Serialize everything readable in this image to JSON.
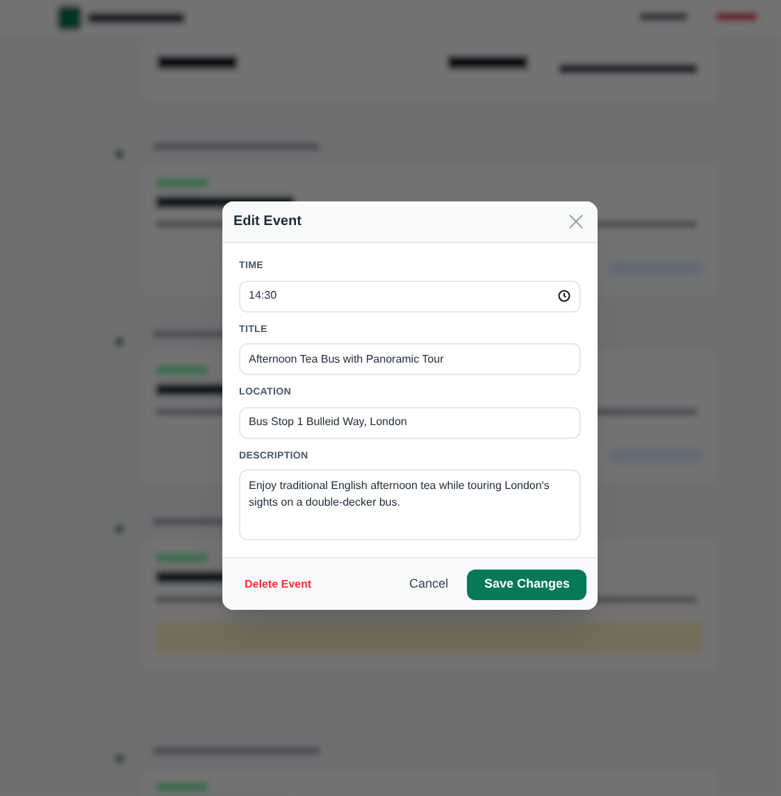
{
  "dialog": {
    "title": "Edit Event",
    "fields": [
      {
        "label": "TIME",
        "kind": "time",
        "value": "14:30"
      },
      {
        "label": "TITLE",
        "kind": "text",
        "value": "Afternoon Tea Bus with Panoramic Tour"
      },
      {
        "label": "LOCATION",
        "kind": "text",
        "value": "Bus Stop 1 Bulleid Way, London"
      },
      {
        "label": "DESCRIPTION",
        "kind": "textarea",
        "value": "Enjoy traditional English afternoon tea while touring London's sights on a double-decker bus."
      }
    ],
    "delete_button": "Delete Event",
    "cancel_button": "Cancel",
    "save_button": "Save Changes"
  }
}
